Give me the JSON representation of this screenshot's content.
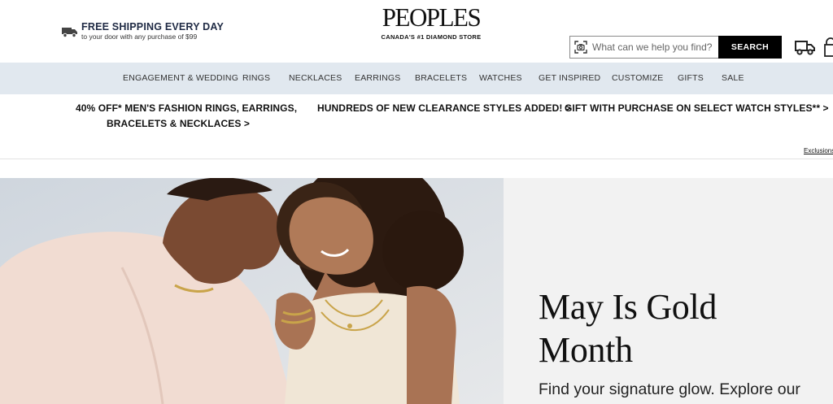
{
  "header": {
    "shipping_title": "FREE SHIPPING EVERY DAY",
    "shipping_sub": "to your door with any purchase of $99",
    "logo": "PEOPLES",
    "tagline": "CANADA'S #1 DIAMOND STORE",
    "search_placeholder": "What can we help you find?",
    "search_button": "SEARCH"
  },
  "nav": {
    "items": [
      "ENGAGEMENT & WEDDING",
      "RINGS",
      "NECKLACES",
      "EARRINGS",
      "BRACELETS",
      "WATCHES",
      "GET INSPIRED",
      "CUSTOMIZE",
      "GIFTS",
      "SALE"
    ]
  },
  "promos": {
    "promo1_line1": "40% OFF* MEN'S FASHION RINGS, EARRINGS,",
    "promo1_line2": "BRACELETS & NECKLACES >",
    "promo2": "HUNDREDS OF NEW CLEARANCE STYLES ADDED! >",
    "promo3": "GIFT WITH PURCHASE ON SELECT WATCH STYLES** >",
    "exclusions": "Exclusions"
  },
  "hero": {
    "title_line1": "May Is Gold",
    "title_line2": "Month",
    "subtitle": "Find your signature glow. Explore our",
    "panel_color": "#f2f2f2"
  },
  "icons": {
    "shipping": "truck-icon",
    "visual_search": "camera-scan-icon",
    "delivery": "truck-icon",
    "cart": "shopping-bag-icon"
  },
  "colors": {
    "nav_bg": "#e1e8ef",
    "shipping_title": "#1f2a44",
    "search_button_bg": "#000000"
  }
}
